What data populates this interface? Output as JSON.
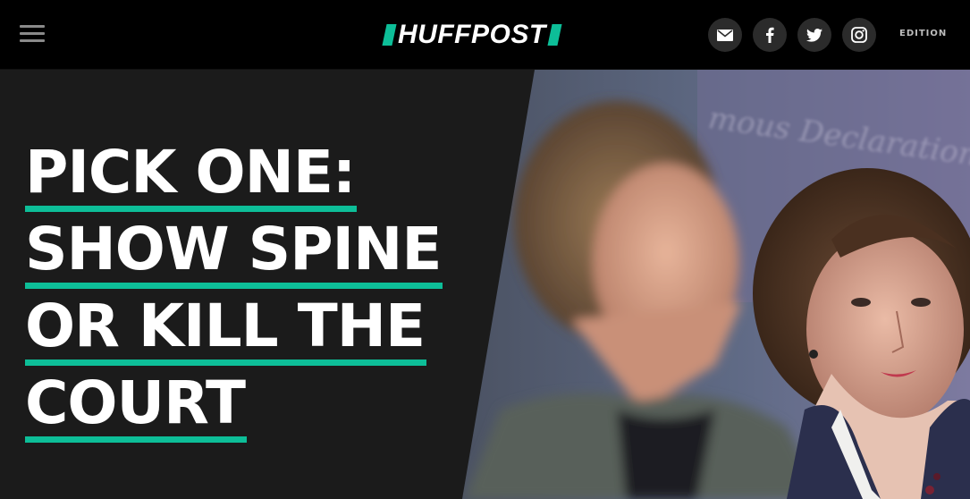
{
  "header": {
    "logo_text": "HUFFPOST",
    "edition_label": "EDITION",
    "accent_color": "#0dbe98",
    "icons": [
      "menu-icon",
      "email-icon",
      "facebook-icon",
      "twitter-icon",
      "instagram-icon"
    ]
  },
  "hero": {
    "headline_lines": [
      "PICK ONE:",
      "SHOW SPINE",
      "OR KILL THE",
      "COURT"
    ],
    "image_description": "",
    "background_text": "mous Declaration"
  }
}
